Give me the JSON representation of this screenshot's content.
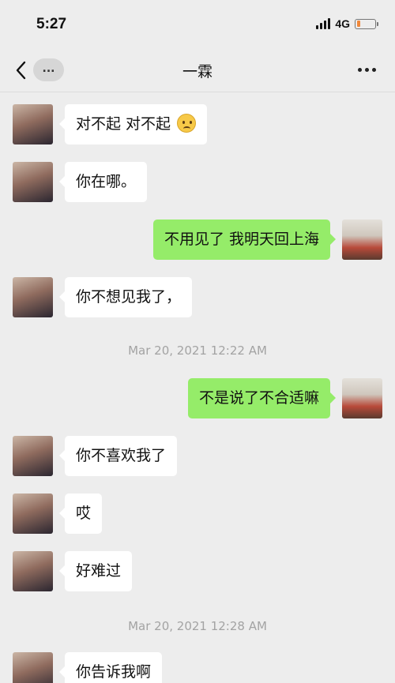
{
  "status": {
    "time": "5:27",
    "network": "4G"
  },
  "header": {
    "more_label": "...",
    "title": "一霖"
  },
  "messages": [
    {
      "text": "对不起 对不起"
    },
    {
      "text": "你在哪。"
    },
    {
      "text": "不用见了 我明天回上海"
    },
    {
      "text": "你不想见我了，"
    },
    {
      "timestamp": "Mar 20, 2021 12:22 AM"
    },
    {
      "text": "不是说了不合适嘛"
    },
    {
      "text": "你不喜欢我了"
    },
    {
      "text": "哎"
    },
    {
      "text": "好难过"
    },
    {
      "timestamp": "Mar 20, 2021 12:28 AM"
    },
    {
      "text": "你告诉我啊"
    }
  ],
  "icons": {
    "emoji": "frowning-face-emoji",
    "back": "back-chevron-icon",
    "menu": "more-menu-icon"
  },
  "colors": {
    "outgoing_bubble": "#95ec69",
    "incoming_bubble": "#ffffff",
    "background": "#ededed"
  }
}
